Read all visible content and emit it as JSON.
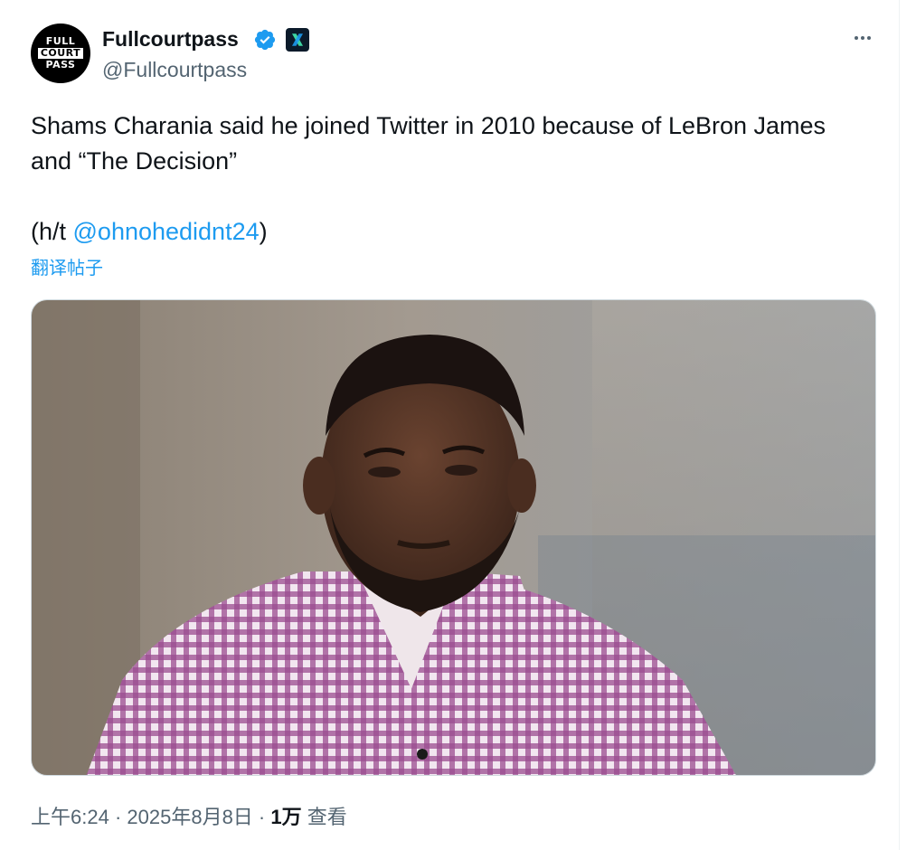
{
  "author": {
    "avatar_text": [
      "FULL",
      "COURT",
      "PASS"
    ],
    "display_name": "Fullcourtpass",
    "handle": "@Fullcourtpass",
    "verified_icon": "verified-badge-icon",
    "affiliate_icon": "x-affiliate-icon"
  },
  "post": {
    "line1": "Shams Charania said he joined Twitter in 2010 because of LeBron James",
    "line2": "and “The Decision”",
    "ht_prefix": "(h/t ",
    "mention": "@ohnohedidnt24",
    "ht_suffix": ")",
    "translate_label": "翻译帖子"
  },
  "media": {
    "type": "photo",
    "description_icon": "photo-image"
  },
  "meta": {
    "time": "上午6:24",
    "sep1": " · ",
    "date": "2025年8月8日",
    "sep2": " · ",
    "views_count": "1万",
    "views_label": " 查看"
  },
  "colors": {
    "accent": "#1d9bf0",
    "secondary_text": "#536471",
    "primary_text": "#0f1419"
  }
}
